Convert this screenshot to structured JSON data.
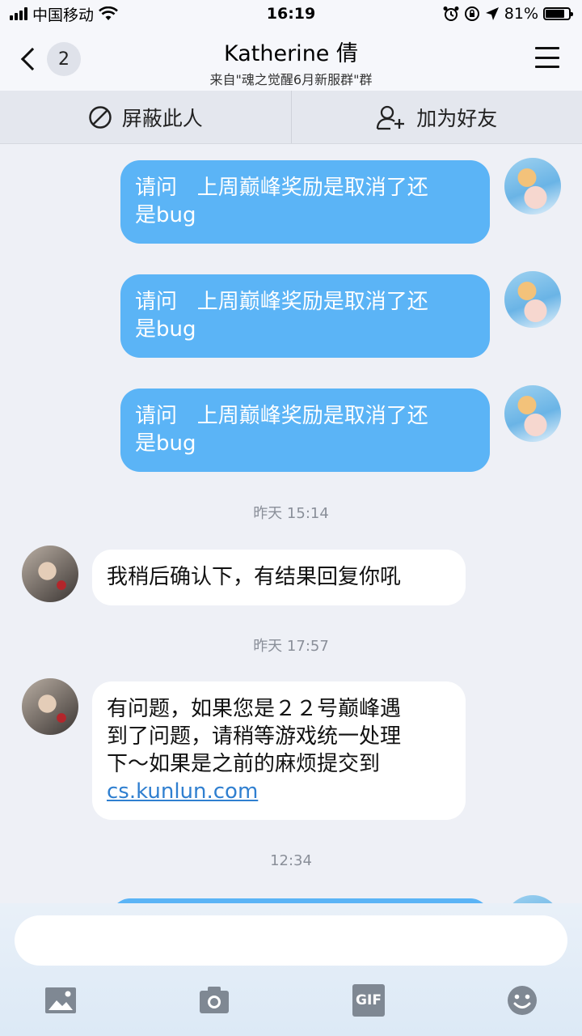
{
  "status_bar": {
    "carrier": "中国移动",
    "time": "16:19",
    "battery": "81%"
  },
  "header": {
    "back_count": "2",
    "title": "Katherine 倩",
    "subtitle": "来自\"魂之觉醒6月新服群\"群"
  },
  "actions": {
    "block": "屏蔽此人",
    "add_friend": "加为好友"
  },
  "messages": {
    "m1": {
      "line1": "请问   上周巅峰奖励是取消了还",
      "line2": "是bug"
    },
    "m2": {
      "line1": "请问   上周巅峰奖励是取消了还",
      "line2": "是bug"
    },
    "m3": {
      "line1": "请问   上周巅峰奖励是取消了还",
      "line2": "是bug"
    },
    "t1": "昨天 15:14",
    "m4": {
      "line1": "我稍后确认下，有结果回复你吼"
    },
    "t2": "昨天 17:57",
    "m5": {
      "line1": "有问题，如果您是２２号巅峰遇",
      "line2": "到了问题，请稍等游戏统一处理",
      "line3": "下～如果是之前的麻烦提交到",
      "link": "cs.kunlun.com"
    },
    "t3": "12:34"
  },
  "input": {
    "placeholder": ""
  },
  "toolbar": {
    "icons": [
      "image-icon",
      "camera-icon",
      "gif-icon",
      "emoji-icon"
    ],
    "gif_label": "GIF"
  },
  "colors": {
    "bubble_me": "#5bb4f6",
    "bubble_other": "#ffffff",
    "background": "#eef0f6",
    "link": "#2f7fd0"
  }
}
